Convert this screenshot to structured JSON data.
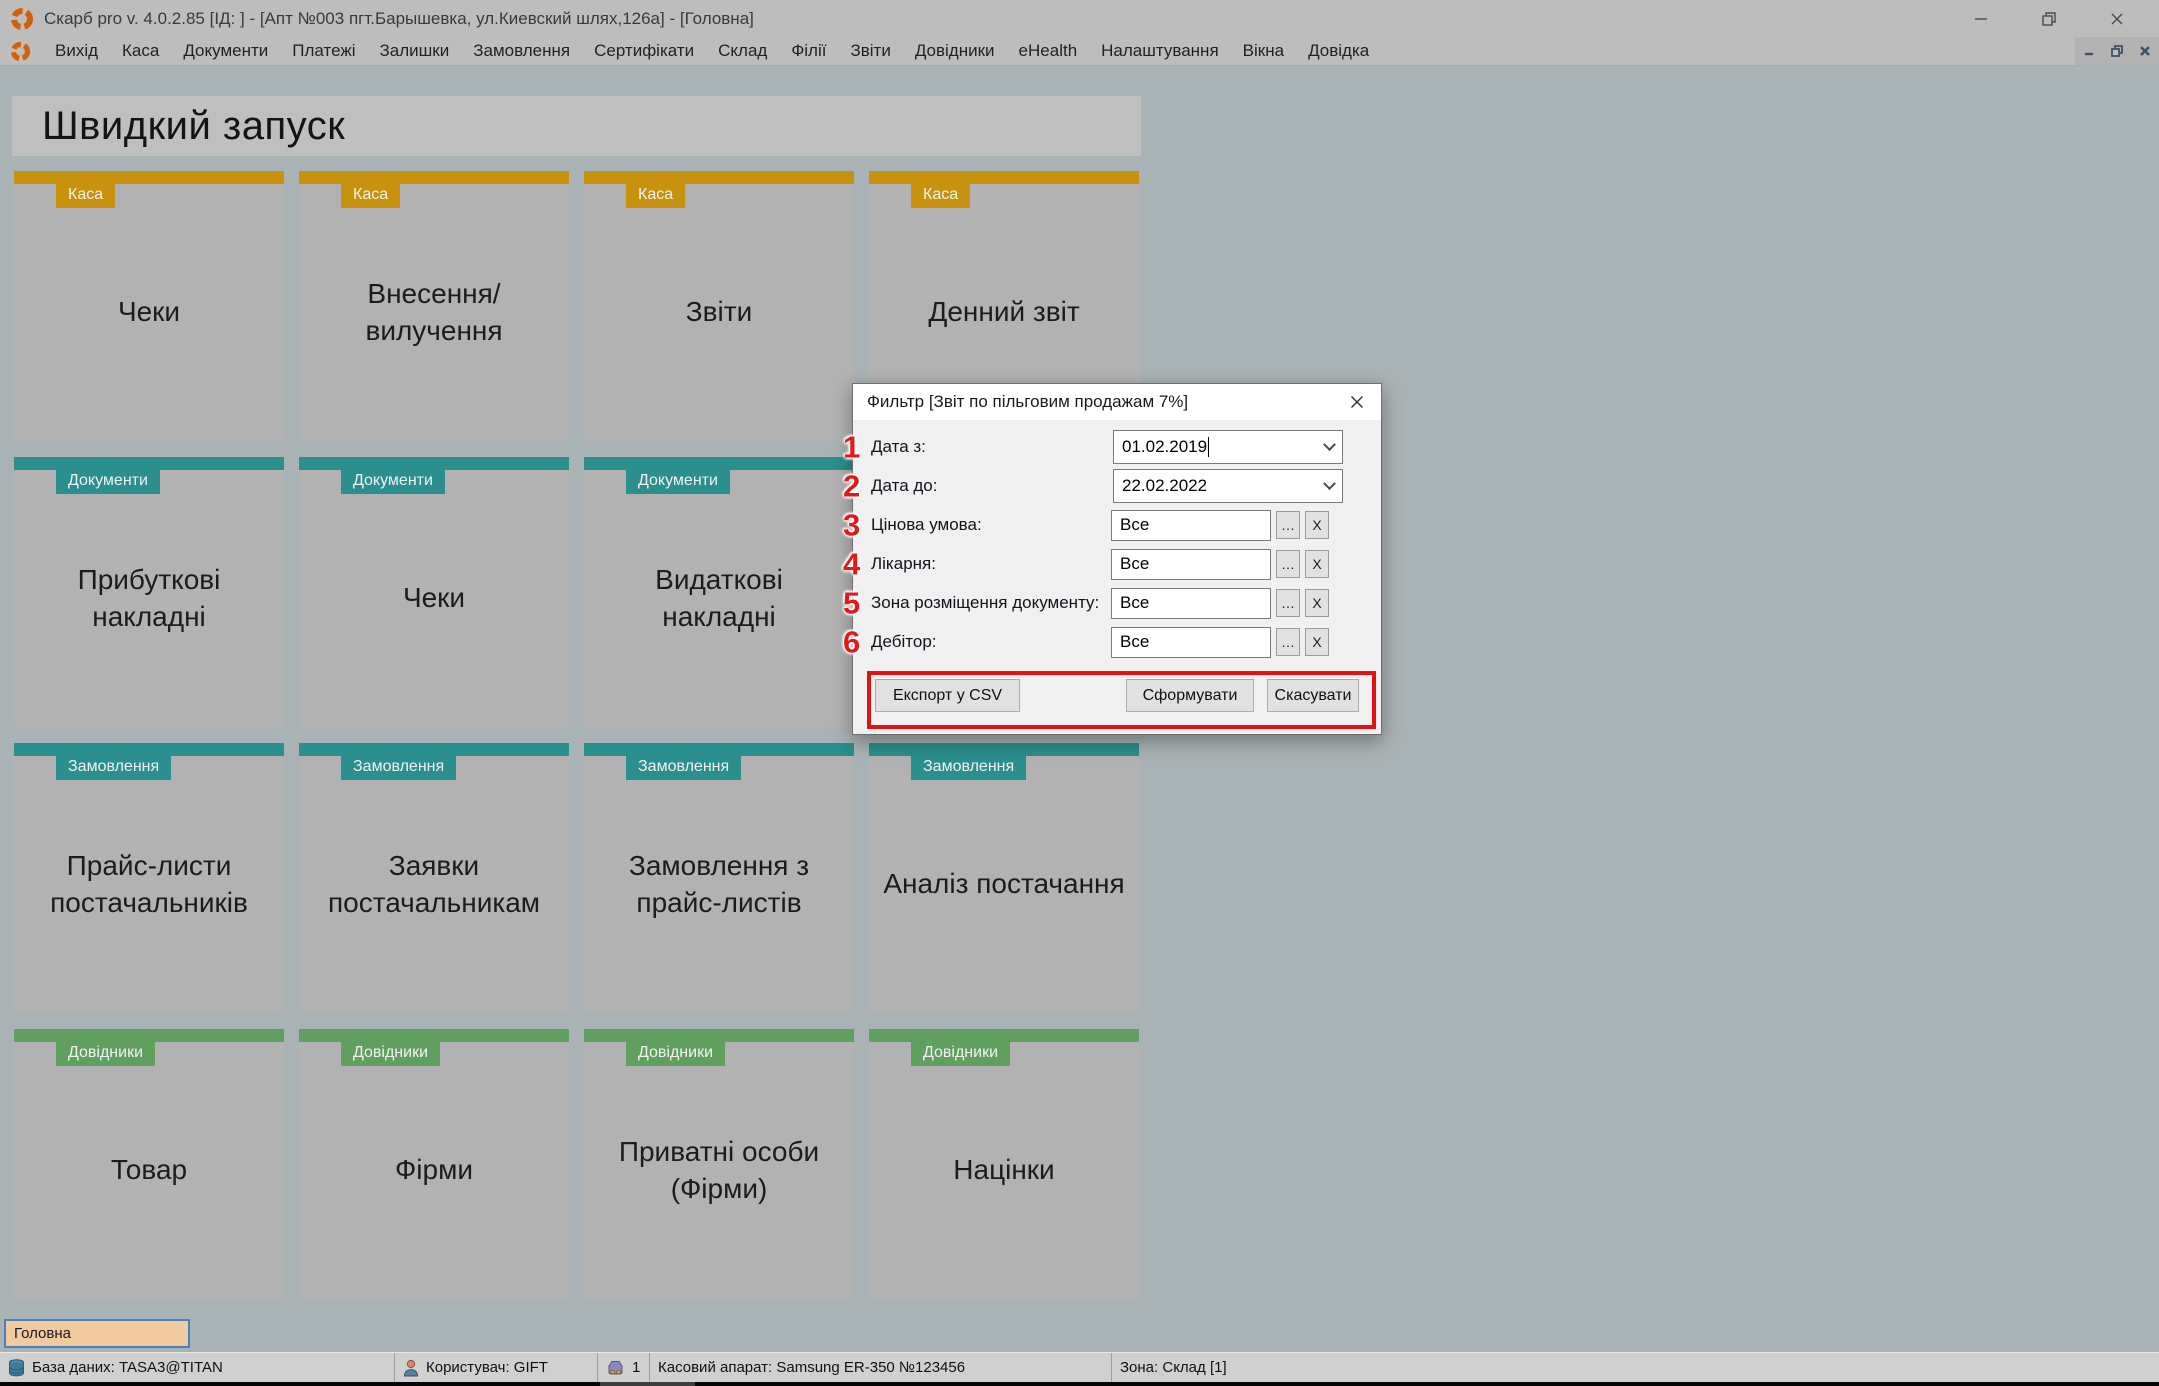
{
  "window": {
    "title": "Скарб pro v. 4.0.2.85 [ІД:      ] - [Апт №003 пгт.Барышевка, ул.Киевский шлях,126а] - [Головна]"
  },
  "menu": {
    "items": [
      "Вихід",
      "Каса",
      "Документи",
      "Платежі",
      "Залишки",
      "Замовлення",
      "Сертифікати",
      "Склад",
      "Філії",
      "Звіти",
      "Довідники",
      "eHealth",
      "Налаштування",
      "Вікна",
      "Довідка"
    ]
  },
  "quick_launch": {
    "title": "Швидкий запуск",
    "tiles": [
      {
        "category": "Каса",
        "label": "Чеки"
      },
      {
        "category": "Каса",
        "label": "Внесення/вилучення"
      },
      {
        "category": "Каса",
        "label": "Звіти"
      },
      {
        "category": "Каса",
        "label": "Денний звіт"
      },
      {
        "category": "Документи",
        "label": "Прибуткові накладні"
      },
      {
        "category": "Документи",
        "label": "Чеки"
      },
      {
        "category": "Документи",
        "label": "Видаткові накладні"
      },
      {
        "category": "",
        "label": ""
      },
      {
        "category": "Замовлення",
        "label": "Прайс-листи постачальників"
      },
      {
        "category": "Замовлення",
        "label": "Заявки постачальникам"
      },
      {
        "category": "Замовлення",
        "label": "Замовлення з прайс-листів"
      },
      {
        "category": "Замовлення",
        "label": "Аналіз постачання"
      },
      {
        "category": "Довідники",
        "label": "Товар"
      },
      {
        "category": "Довідники",
        "label": "Фірми"
      },
      {
        "category": "Довідники",
        "label": "Приватні особи (Фірми)"
      },
      {
        "category": "Довідники",
        "label": "Націнки"
      }
    ]
  },
  "colors": {
    "category_kasa": "#C8920E",
    "category_documents": "#2A8F8D",
    "category_orders": "#2A8F8D",
    "category_handbooks": "#5FA05F",
    "annotation_red": "#E01212",
    "tab_fill": "#F1CA9F",
    "background": "#A9B2B4"
  },
  "filter_dialog": {
    "title": "Фильтр [Звіт по пільговим продажам 7%]",
    "fields": [
      {
        "num": "1",
        "label": "Дата з:",
        "value": "01.02.2019"
      },
      {
        "num": "2",
        "label": "Дата до:",
        "value": "22.02.2022"
      },
      {
        "num": "3",
        "label": "Цінова умова:",
        "value": "Все"
      },
      {
        "num": "4",
        "label": "Лікарня:",
        "value": "Все"
      },
      {
        "num": "5",
        "label": "Зона розміщення документу:",
        "value": "Все"
      },
      {
        "num": "6",
        "label": "Дебітор:",
        "value": "Все"
      }
    ],
    "picker_more": "…",
    "picker_clear": "X",
    "buttons": {
      "export": "Експорт у CSV",
      "generate": "Сформувати",
      "cancel": "Скасувати"
    }
  },
  "tabs": {
    "active": "Головна"
  },
  "status_bar": {
    "database": "База даних: TASA3@TITAN",
    "user": "Користувач: GIFT",
    "device_count": "1",
    "cash_register": "Касовий апарат: Samsung ER-350 №123456",
    "zone": "Зона: Склад [1]"
  }
}
